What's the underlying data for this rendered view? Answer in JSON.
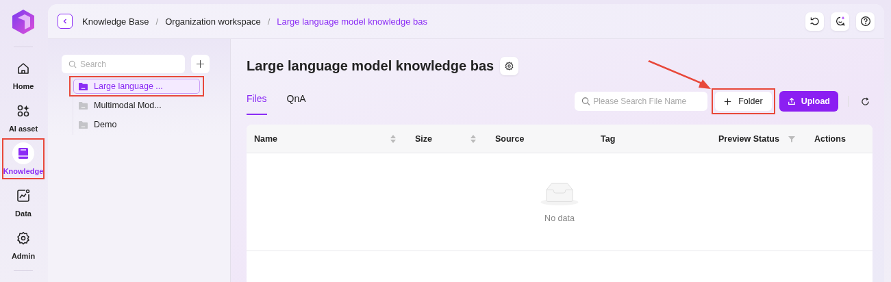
{
  "nav": [
    {
      "label": "Home",
      "selected": false,
      "highlighted": false
    },
    {
      "label": "AI asset",
      "selected": false,
      "highlighted": false
    },
    {
      "label": "Knowledge",
      "selected": true,
      "highlighted": true
    },
    {
      "label": "Data",
      "selected": false,
      "highlighted": false
    },
    {
      "label": "Admin",
      "selected": false,
      "highlighted": false
    }
  ],
  "breadcrumb": [
    {
      "label": "Knowledge Base",
      "current": false
    },
    {
      "label": "Organization workspace",
      "current": false
    },
    {
      "label": "Large language model knowledge bas",
      "current": true
    }
  ],
  "separator": "/",
  "tree": {
    "search_placeholder": "Search",
    "items": [
      {
        "label": "Large language ...",
        "selected": true,
        "highlighted": true
      },
      {
        "label": "Multimodal Mod...",
        "selected": false,
        "highlighted": false
      },
      {
        "label": "Demo",
        "selected": false,
        "highlighted": false
      }
    ]
  },
  "title": "Large language model knowledge bas",
  "tabs": [
    {
      "label": "Files",
      "selected": true
    },
    {
      "label": "QnA",
      "selected": false
    }
  ],
  "file_search": {
    "placeholder": "Please Search File Name"
  },
  "folder_button": {
    "label": "Folder",
    "highlighted": true
  },
  "upload_button": {
    "label": "Upload"
  },
  "table": {
    "columns": [
      {
        "label": "Name",
        "sortable": true,
        "filterable": false
      },
      {
        "label": "Size",
        "sortable": true,
        "filterable": false
      },
      {
        "label": "Source",
        "sortable": false,
        "filterable": false
      },
      {
        "label": "Tag",
        "sortable": false,
        "filterable": false
      },
      {
        "label": "Preview Status",
        "sortable": false,
        "filterable": true
      },
      {
        "label": "Actions",
        "sortable": false,
        "filterable": false
      }
    ],
    "empty_text": "No data"
  }
}
